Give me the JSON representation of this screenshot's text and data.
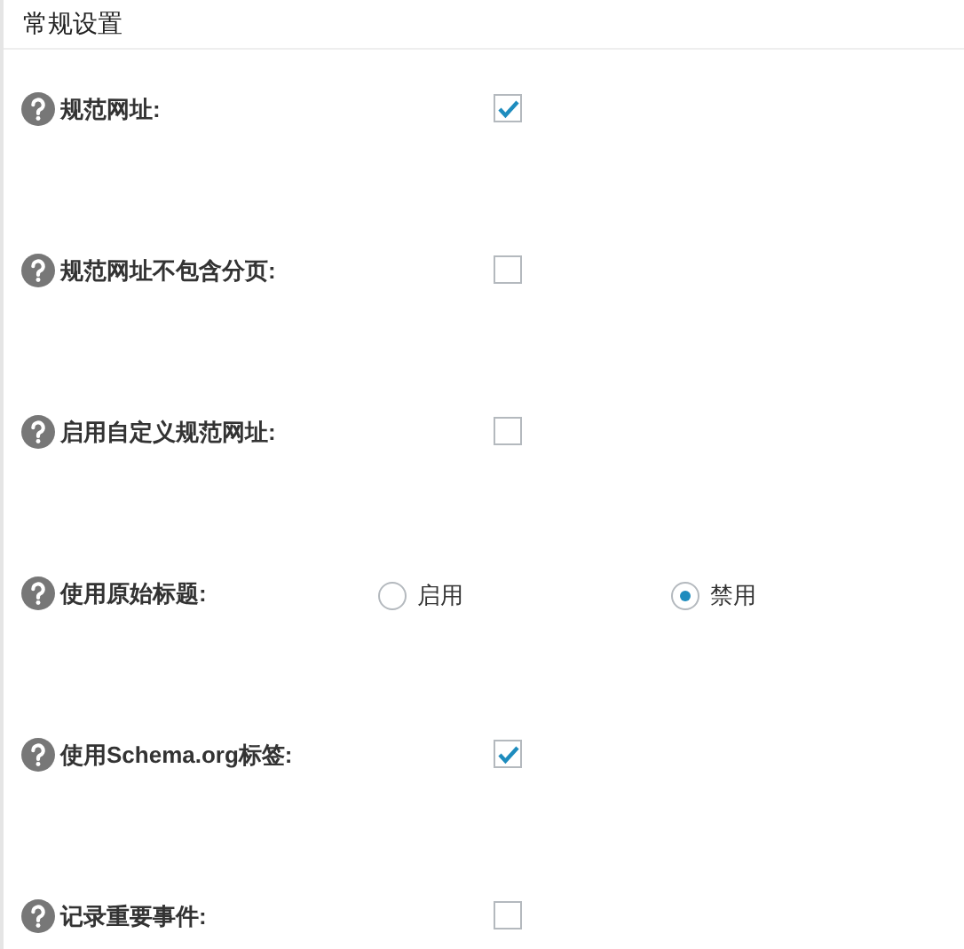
{
  "section_title": "常规设置",
  "settings": [
    {
      "kind": "checkbox",
      "label": "规范网址:",
      "checked": true
    },
    {
      "kind": "checkbox",
      "label": "规范网址不包含分页:",
      "checked": false
    },
    {
      "kind": "checkbox",
      "label": "启用自定义规范网址:",
      "checked": false
    },
    {
      "kind": "radio",
      "label": "使用原始标题:",
      "options": [
        {
          "label": "启用",
          "selected": false
        },
        {
          "label": "禁用",
          "selected": true
        }
      ]
    },
    {
      "kind": "checkbox",
      "label": "使用Schema.org标签:",
      "checked": true
    },
    {
      "kind": "checkbox",
      "label": "记录重要事件:",
      "checked": false
    }
  ]
}
